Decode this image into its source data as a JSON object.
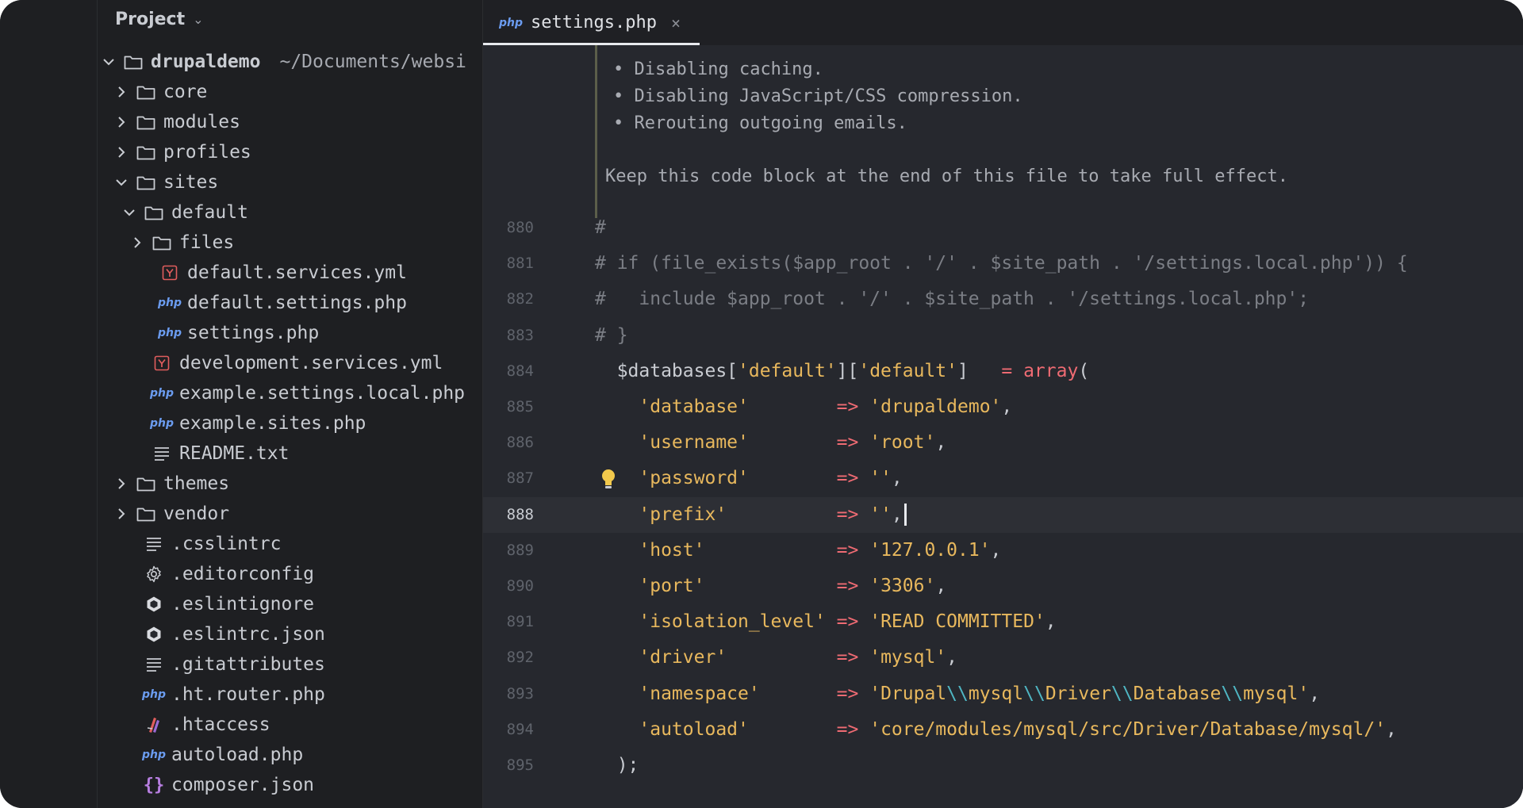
{
  "project_panel": {
    "title": "Project",
    "tree": [
      {
        "label": "drupaldemo",
        "hint": "~/Documents/websi",
        "type": "folder",
        "expanded": true,
        "depth": 0,
        "bold": true
      },
      {
        "label": "core",
        "type": "folder",
        "expanded": false,
        "depth": 1
      },
      {
        "label": "modules",
        "type": "folder",
        "expanded": false,
        "depth": 1
      },
      {
        "label": "profiles",
        "type": "folder",
        "expanded": false,
        "depth": 1
      },
      {
        "label": "sites",
        "type": "folder",
        "expanded": true,
        "depth": 1
      },
      {
        "label": "default",
        "type": "folder",
        "expanded": true,
        "depth": 2
      },
      {
        "label": "files",
        "type": "folder",
        "expanded": false,
        "depth": 3
      },
      {
        "label": "default.services.yml",
        "type": "yml",
        "depth": 4
      },
      {
        "label": "default.settings.php",
        "type": "php",
        "depth": 4
      },
      {
        "label": "settings.php",
        "type": "php",
        "depth": 4
      },
      {
        "label": "development.services.yml",
        "type": "yml",
        "depth": 3
      },
      {
        "label": "example.settings.local.php",
        "type": "php",
        "depth": 3
      },
      {
        "label": "example.sites.php",
        "type": "php",
        "depth": 3
      },
      {
        "label": "README.txt",
        "type": "text",
        "depth": 3
      },
      {
        "label": "themes",
        "type": "folder",
        "expanded": false,
        "depth": 1
      },
      {
        "label": "vendor",
        "type": "folder",
        "expanded": false,
        "depth": 1
      },
      {
        "label": ".csslintrc",
        "type": "text",
        "depth": 2
      },
      {
        "label": ".editorconfig",
        "type": "gear",
        "depth": 2
      },
      {
        "label": ".eslintignore",
        "type": "eslint",
        "depth": 2
      },
      {
        "label": ".eslintrc.json",
        "type": "eslint",
        "depth": 2
      },
      {
        "label": ".gitattributes",
        "type": "text",
        "depth": 2
      },
      {
        "label": ".ht.router.php",
        "type": "php",
        "depth": 2
      },
      {
        "label": ".htaccess",
        "type": "htaccess",
        "depth": 2
      },
      {
        "label": "autoload.php",
        "type": "php",
        "depth": 2
      },
      {
        "label": "composer.json",
        "type": "json",
        "depth": 2
      }
    ]
  },
  "editor": {
    "tab": {
      "badge": "php",
      "label": "settings.php",
      "close": "×"
    },
    "doc_comment": {
      "bullets": [
        "Disabling caching.",
        "Disabling JavaScript/CSS compression.",
        "Rerouting outgoing emails."
      ],
      "bullet_char": "•",
      "paragraph": "Keep this code block at the end of this file to take full effect."
    },
    "lines": [
      {
        "num": "880",
        "tokens": [
          {
            "t": "#",
            "c": "cmt"
          }
        ]
      },
      {
        "num": "881",
        "tokens": [
          {
            "t": "# if (file_exists($app_root . '/' . $site_path . '/settings.local.php')) {",
            "c": "cmt"
          }
        ]
      },
      {
        "num": "882",
        "tokens": [
          {
            "t": "#   include $app_root . '/' . $site_path . '/settings.local.php';",
            "c": "cmt"
          }
        ]
      },
      {
        "num": "883",
        "tokens": [
          {
            "t": "# }",
            "c": "cmt"
          }
        ]
      },
      {
        "num": "884",
        "tokens": [
          {
            "t": "  $databases[",
            "c": "plain"
          },
          {
            "t": "'default'",
            "c": "str"
          },
          {
            "t": "][",
            "c": "plain"
          },
          {
            "t": "'default'",
            "c": "str"
          },
          {
            "t": "]   ",
            "c": "plain"
          },
          {
            "t": "= ",
            "c": "op"
          },
          {
            "t": "array",
            "c": "kw"
          },
          {
            "t": "(",
            "c": "plain"
          }
        ]
      },
      {
        "num": "885",
        "tokens": [
          {
            "t": "    ",
            "c": "plain"
          },
          {
            "t": "'database'",
            "c": "str"
          },
          {
            "t": "        ",
            "c": "plain"
          },
          {
            "t": "=>",
            "c": "op"
          },
          {
            "t": " ",
            "c": "plain"
          },
          {
            "t": "'drupaldemo'",
            "c": "str"
          },
          {
            "t": ",",
            "c": "plain"
          }
        ]
      },
      {
        "num": "886",
        "tokens": [
          {
            "t": "    ",
            "c": "plain"
          },
          {
            "t": "'username'",
            "c": "str"
          },
          {
            "t": "        ",
            "c": "plain"
          },
          {
            "t": "=>",
            "c": "op"
          },
          {
            "t": " ",
            "c": "plain"
          },
          {
            "t": "'root'",
            "c": "str"
          },
          {
            "t": ",",
            "c": "plain"
          }
        ]
      },
      {
        "num": "887",
        "tokens": [
          {
            "t": "    ",
            "c": "plain"
          },
          {
            "t": "'password'",
            "c": "str"
          },
          {
            "t": "        ",
            "c": "plain"
          },
          {
            "t": "=>",
            "c": "op"
          },
          {
            "t": " ",
            "c": "plain"
          },
          {
            "t": "''",
            "c": "str"
          },
          {
            "t": ",",
            "c": "plain"
          }
        ],
        "bulb": true
      },
      {
        "num": "888",
        "tokens": [
          {
            "t": "    ",
            "c": "plain"
          },
          {
            "t": "'prefix'",
            "c": "str"
          },
          {
            "t": "          ",
            "c": "plain"
          },
          {
            "t": "=>",
            "c": "op"
          },
          {
            "t": " ",
            "c": "plain"
          },
          {
            "t": "''",
            "c": "str"
          },
          {
            "t": ",",
            "c": "plain"
          }
        ],
        "current": true
      },
      {
        "num": "889",
        "tokens": [
          {
            "t": "    ",
            "c": "plain"
          },
          {
            "t": "'host'",
            "c": "str"
          },
          {
            "t": "            ",
            "c": "plain"
          },
          {
            "t": "=>",
            "c": "op"
          },
          {
            "t": " ",
            "c": "plain"
          },
          {
            "t": "'127.0.0.1'",
            "c": "str"
          },
          {
            "t": ",",
            "c": "plain"
          }
        ]
      },
      {
        "num": "890",
        "tokens": [
          {
            "t": "    ",
            "c": "plain"
          },
          {
            "t": "'port'",
            "c": "str"
          },
          {
            "t": "            ",
            "c": "plain"
          },
          {
            "t": "=>",
            "c": "op"
          },
          {
            "t": " ",
            "c": "plain"
          },
          {
            "t": "'3306'",
            "c": "str"
          },
          {
            "t": ",",
            "c": "plain"
          }
        ]
      },
      {
        "num": "891",
        "tokens": [
          {
            "t": "    ",
            "c": "plain"
          },
          {
            "t": "'isolation_level'",
            "c": "str"
          },
          {
            "t": " ",
            "c": "plain"
          },
          {
            "t": "=>",
            "c": "op"
          },
          {
            "t": " ",
            "c": "plain"
          },
          {
            "t": "'READ COMMITTED'",
            "c": "str"
          },
          {
            "t": ",",
            "c": "plain"
          }
        ]
      },
      {
        "num": "892",
        "tokens": [
          {
            "t": "    ",
            "c": "plain"
          },
          {
            "t": "'driver'",
            "c": "str"
          },
          {
            "t": "          ",
            "c": "plain"
          },
          {
            "t": "=>",
            "c": "op"
          },
          {
            "t": " ",
            "c": "plain"
          },
          {
            "t": "'mysql'",
            "c": "str"
          },
          {
            "t": ",",
            "c": "plain"
          }
        ]
      },
      {
        "num": "893",
        "tokens": [
          {
            "t": "    ",
            "c": "plain"
          },
          {
            "t": "'namespace'",
            "c": "str"
          },
          {
            "t": "       ",
            "c": "plain"
          },
          {
            "t": "=>",
            "c": "op"
          },
          {
            "t": " ",
            "c": "plain"
          },
          {
            "t": "'Drupal",
            "c": "str"
          },
          {
            "t": "\\\\",
            "c": "esc"
          },
          {
            "t": "mysql",
            "c": "str"
          },
          {
            "t": "\\\\",
            "c": "esc"
          },
          {
            "t": "Driver",
            "c": "str"
          },
          {
            "t": "\\\\",
            "c": "esc"
          },
          {
            "t": "Database",
            "c": "str"
          },
          {
            "t": "\\\\",
            "c": "esc"
          },
          {
            "t": "mysql'",
            "c": "str"
          },
          {
            "t": ",",
            "c": "plain"
          }
        ]
      },
      {
        "num": "894",
        "tokens": [
          {
            "t": "    ",
            "c": "plain"
          },
          {
            "t": "'autoload'",
            "c": "str"
          },
          {
            "t": "        ",
            "c": "plain"
          },
          {
            "t": "=>",
            "c": "op"
          },
          {
            "t": " ",
            "c": "plain"
          },
          {
            "t": "'core/modules/mysql/src/Driver/Database/mysql/'",
            "c": "str"
          },
          {
            "t": ",",
            "c": "plain"
          }
        ]
      },
      {
        "num": "895",
        "tokens": [
          {
            "t": "  );",
            "c": "plain"
          }
        ]
      }
    ]
  },
  "colors": {
    "background": "#26282e",
    "string": "#e8b85d",
    "operator": "#ef6b73",
    "comment": "#7b7e85",
    "escape": "#4fb6c3",
    "php_badge": "#6b9cf0",
    "yml_icon": "#e05d5d"
  }
}
